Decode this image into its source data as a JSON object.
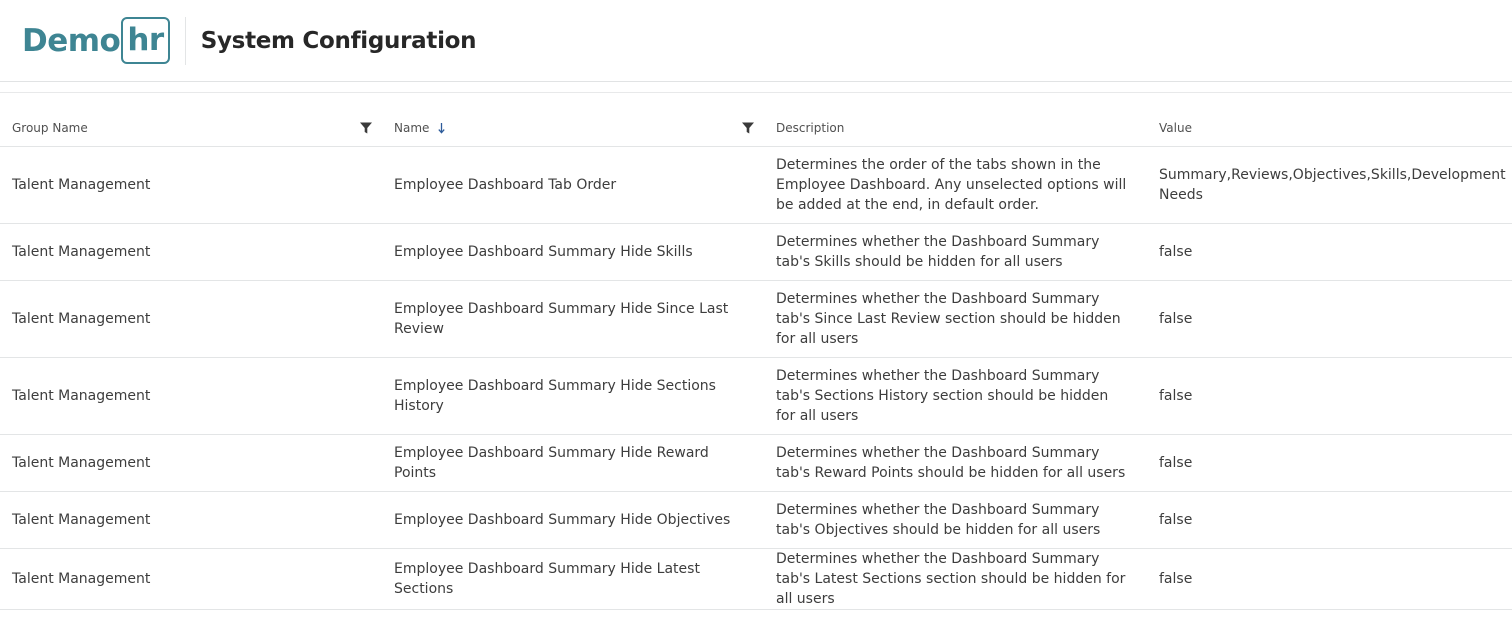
{
  "header": {
    "logo_main": "Demo",
    "logo_box": "hr",
    "title": "System Configuration"
  },
  "table": {
    "columns": [
      {
        "label": "Group Name",
        "filter": true,
        "sort": null
      },
      {
        "label": "Name",
        "filter": true,
        "sort": "ascending"
      },
      {
        "label": "Description",
        "filter": false,
        "sort": null
      },
      {
        "label": "Value",
        "filter": false,
        "sort": null
      }
    ],
    "rows": [
      {
        "group": "Talent Management",
        "name": "Employee Dashboard Tab Order",
        "description": "Determines the order of the tabs shown in the Employee Dashboard. Any unselected options will be added at the end, in default order.",
        "value": "Summary,Reviews,Objectives,Skills,Development Needs"
      },
      {
        "group": "Talent Management",
        "name": "Employee Dashboard Summary Hide Skills",
        "description": "Determines whether the Dashboard Summary tab's Skills should be hidden for all users",
        "value": "false"
      },
      {
        "group": "Talent Management",
        "name": "Employee Dashboard Summary Hide Since Last Review",
        "description": "Determines whether the Dashboard Summary tab's Since Last Review section should be hidden for all users",
        "value": "false"
      },
      {
        "group": "Talent Management",
        "name": "Employee Dashboard Summary Hide Sections History",
        "description": "Determines whether the Dashboard Summary tab's Sections History section should be hidden for all users",
        "value": "false"
      },
      {
        "group": "Talent Management",
        "name": "Employee Dashboard Summary Hide Reward Points",
        "description": "Determines whether the Dashboard Summary tab's Reward Points should be hidden for all users",
        "value": "false"
      },
      {
        "group": "Talent Management",
        "name": "Employee Dashboard Summary Hide Objectives",
        "description": "Determines whether the Dashboard Summary tab's Objectives should be hidden for all users",
        "value": "false"
      },
      {
        "group": "Talent Management",
        "name": "Employee Dashboard Summary Hide Latest Sections",
        "description": "Determines whether the Dashboard Summary tab's Latest Sections section should be hidden for all users",
        "value": "false"
      }
    ]
  },
  "icons": {
    "filter": "filter-icon",
    "sort": "arrow-down-icon"
  },
  "colors": {
    "brand": "#3e8593",
    "sort_arrow": "#2d5b9a"
  }
}
